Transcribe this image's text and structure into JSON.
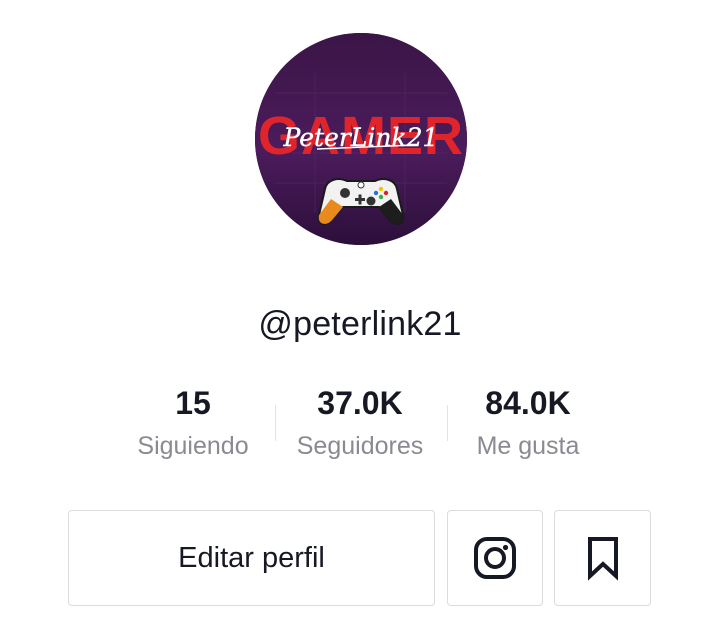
{
  "profile": {
    "avatar_text": "GAMER",
    "avatar_signature": "PeterLink21",
    "username": "@peterlink21"
  },
  "stats": {
    "following": {
      "value": "15",
      "label": "Siguiendo"
    },
    "followers": {
      "value": "37.0K",
      "label": "Seguidores"
    },
    "likes": {
      "value": "84.0K",
      "label": "Me gusta"
    }
  },
  "actions": {
    "edit_profile_label": "Editar perfil",
    "instagram_icon": "instagram-icon",
    "bookmark_icon": "bookmark-icon"
  },
  "colors": {
    "text_primary": "#161823",
    "text_secondary": "#8a8b91",
    "border": "#dcdcde",
    "avatar_bg": "#3a1446",
    "avatar_accent": "#e0242c"
  }
}
